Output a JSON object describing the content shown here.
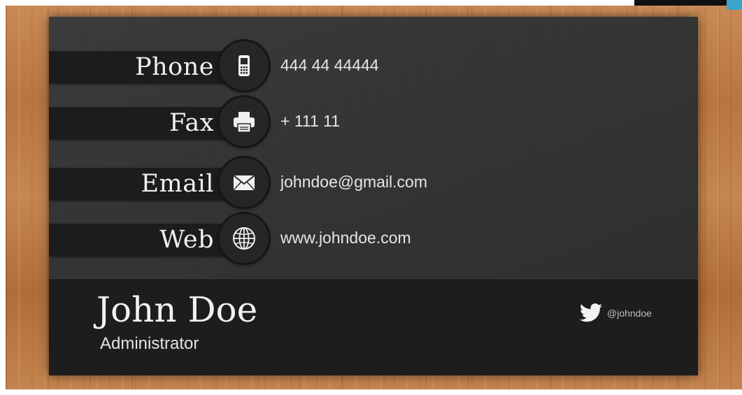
{
  "contact": {
    "rows": [
      {
        "label": "Phone",
        "icon": "phone-icon",
        "value": "444 44 44444"
      },
      {
        "label": "Fax",
        "icon": "printer-icon",
        "value": "+ 111 11"
      },
      {
        "label": "Email",
        "icon": "envelope-icon",
        "value": "johndoe@gmail.com"
      },
      {
        "label": "Web",
        "icon": "globe-icon",
        "value": "www.johndoe.com"
      }
    ]
  },
  "person": {
    "name": "John Doe",
    "title": "Administrator",
    "twitter_icon": "twitter-bird-icon",
    "twitter_handle": "@johndoe"
  },
  "colors": {
    "card": "#333333",
    "band": "#1c1c1c",
    "text": "#f1f1f1",
    "wood": "#c08050"
  }
}
